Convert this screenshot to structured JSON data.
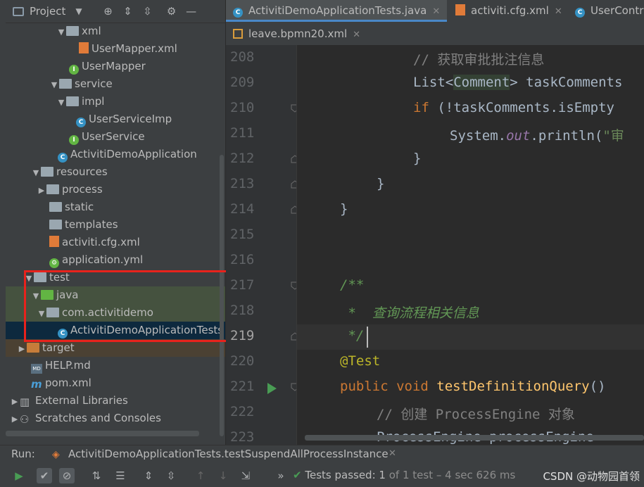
{
  "project_panel": {
    "title": "Project",
    "tree": [
      {
        "label": "xml",
        "icon": "folder",
        "expanded": true
      },
      {
        "label": "UserMapper.xml",
        "icon": "xml-file"
      },
      {
        "label": "UserMapper",
        "icon": "interface"
      },
      {
        "label": "service",
        "icon": "folder",
        "expanded": true
      },
      {
        "label": "impl",
        "icon": "folder",
        "expanded": true
      },
      {
        "label": "UserServiceImp",
        "icon": "class"
      },
      {
        "label": "UserService",
        "icon": "interface"
      },
      {
        "label": "ActivitiDemoApplication",
        "icon": "spring-class"
      },
      {
        "label": "resources",
        "icon": "resources-folder",
        "expanded": true
      },
      {
        "label": "process",
        "icon": "folder",
        "expanded": false
      },
      {
        "label": "static",
        "icon": "folder"
      },
      {
        "label": "templates",
        "icon": "folder"
      },
      {
        "label": "activiti.cfg.xml",
        "icon": "xml-file"
      },
      {
        "label": "application.yml",
        "icon": "yml-file"
      },
      {
        "label": "test",
        "icon": "folder",
        "expanded": true
      },
      {
        "label": "java",
        "icon": "test-source-folder",
        "expanded": true
      },
      {
        "label": "com.activitidemo",
        "icon": "package",
        "expanded": true
      },
      {
        "label": "ActivitiDemoApplicationTests",
        "icon": "class",
        "selected": true
      },
      {
        "label": "target",
        "icon": "excluded-folder",
        "expanded": false
      },
      {
        "label": "HELP.md",
        "icon": "md-file"
      },
      {
        "label": "pom.xml",
        "icon": "maven-file"
      },
      {
        "label": "External Libraries",
        "icon": "libraries",
        "expanded": false
      },
      {
        "label": "Scratches and Consoles",
        "icon": "scratches",
        "expanded": false
      }
    ]
  },
  "editor": {
    "tabs_row1": [
      {
        "label": "ActivitiDemoApplicationTests.java",
        "active": true
      },
      {
        "label": "activiti.cfg.xml",
        "active": false
      },
      {
        "label": "UserContr",
        "active": false
      }
    ],
    "tabs_row2": [
      {
        "label": "leave.bpmn20.xml",
        "active": false
      }
    ],
    "line_numbers": [
      "208",
      "209",
      "210",
      "211",
      "212",
      "213",
      "214",
      "215",
      "216",
      "217",
      "218",
      "219",
      "220",
      "221",
      "222",
      "223"
    ],
    "lines": {
      "l208": "// 获取审批批注信息",
      "l209_a": "List<",
      "l209_b": "Comment",
      "l209_c": "> taskComments",
      "l210_a": "if",
      "l210_b": " (!taskComments.isEmpty",
      "l211_a": "System.",
      "l211_b": "out",
      "l211_c": ".println(",
      "l211_d": "\"审",
      "l212": "}",
      "l213": "}",
      "l214": "}",
      "l217": "/**",
      "l218": " *  查询流程相关信息",
      "l219": " */",
      "l220": "@Test",
      "l221_a": "public void ",
      "l221_b": "testDefinitionQuery",
      "l221_c": "()",
      "l222": "// 创建 ProcessEngine 对象",
      "l223": "ProcessEngine processEngine ="
    }
  },
  "run_panel": {
    "label": "Run:",
    "config": "ActivitiDemoApplicationTests.testSuspendAllProcessInstance",
    "status_prefix": "Tests passed:",
    "status_count": "1",
    "status_detail": "of 1 test – 4 sec 626 ms"
  },
  "watermark": "CSDN @动物园首领"
}
